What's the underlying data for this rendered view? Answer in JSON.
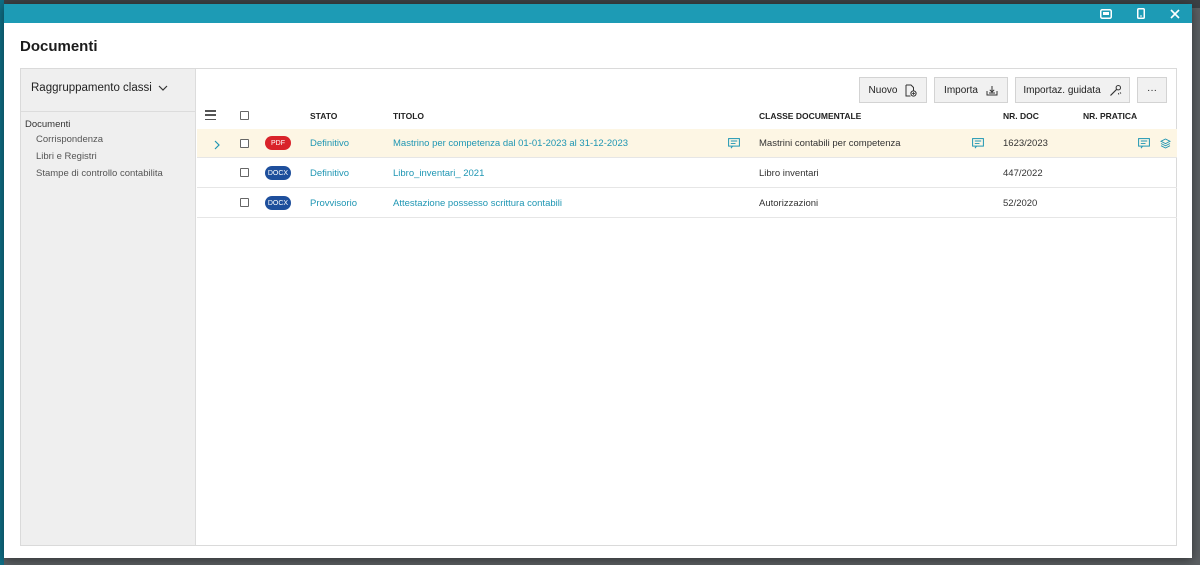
{
  "window": {
    "title": "Documenti",
    "controls": [
      "window-mode-icon",
      "mobile-icon",
      "close-icon"
    ]
  },
  "sidebar": {
    "group_label": "Raggruppamento classi",
    "tree_root": "Documenti",
    "items": [
      {
        "label": "Corrispondenza"
      },
      {
        "label": "Libri e Registri"
      },
      {
        "label": "Stampe di controllo contabilita"
      }
    ]
  },
  "toolbar": {
    "new_label": "Nuovo",
    "import_label": "Importa",
    "guided_import_label": "Importaz. guidata",
    "more_label": "···"
  },
  "table": {
    "columns": {
      "stato": "STATO",
      "titolo": "TITOLO",
      "classe": "CLASSE DOCUMENTALE",
      "nr_doc": "NR. DOC",
      "nr_pratica": "NR. PRATICA"
    },
    "rows": [
      {
        "type": "PDF",
        "stato": "Definitivo",
        "titolo": "Mastrino per competenza dal 01-01-2023 al 31-12-2023",
        "classe": "Mastrini contabili per competenza",
        "nr_doc": "1623/2023",
        "nr_pratica": ""
      },
      {
        "type": "DOCX",
        "stato": "Definitivo",
        "titolo": "Libro_inventari_ 2021",
        "classe": "Libro inventari",
        "nr_doc": "447/2022",
        "nr_pratica": ""
      },
      {
        "type": "DOCX",
        "stato": "Provvisorio",
        "titolo": "Attestazione possesso scrittura contabili",
        "classe": "Autorizzazioni",
        "nr_doc": "52/2020",
        "nr_pratica": ""
      }
    ]
  },
  "colors": {
    "titlebar": "#1d9bb5",
    "link": "#1f96b3",
    "pdf_badge": "#d9232a",
    "docx_badge": "#1e4f9c",
    "highlight_row": "#fdf6e4"
  }
}
